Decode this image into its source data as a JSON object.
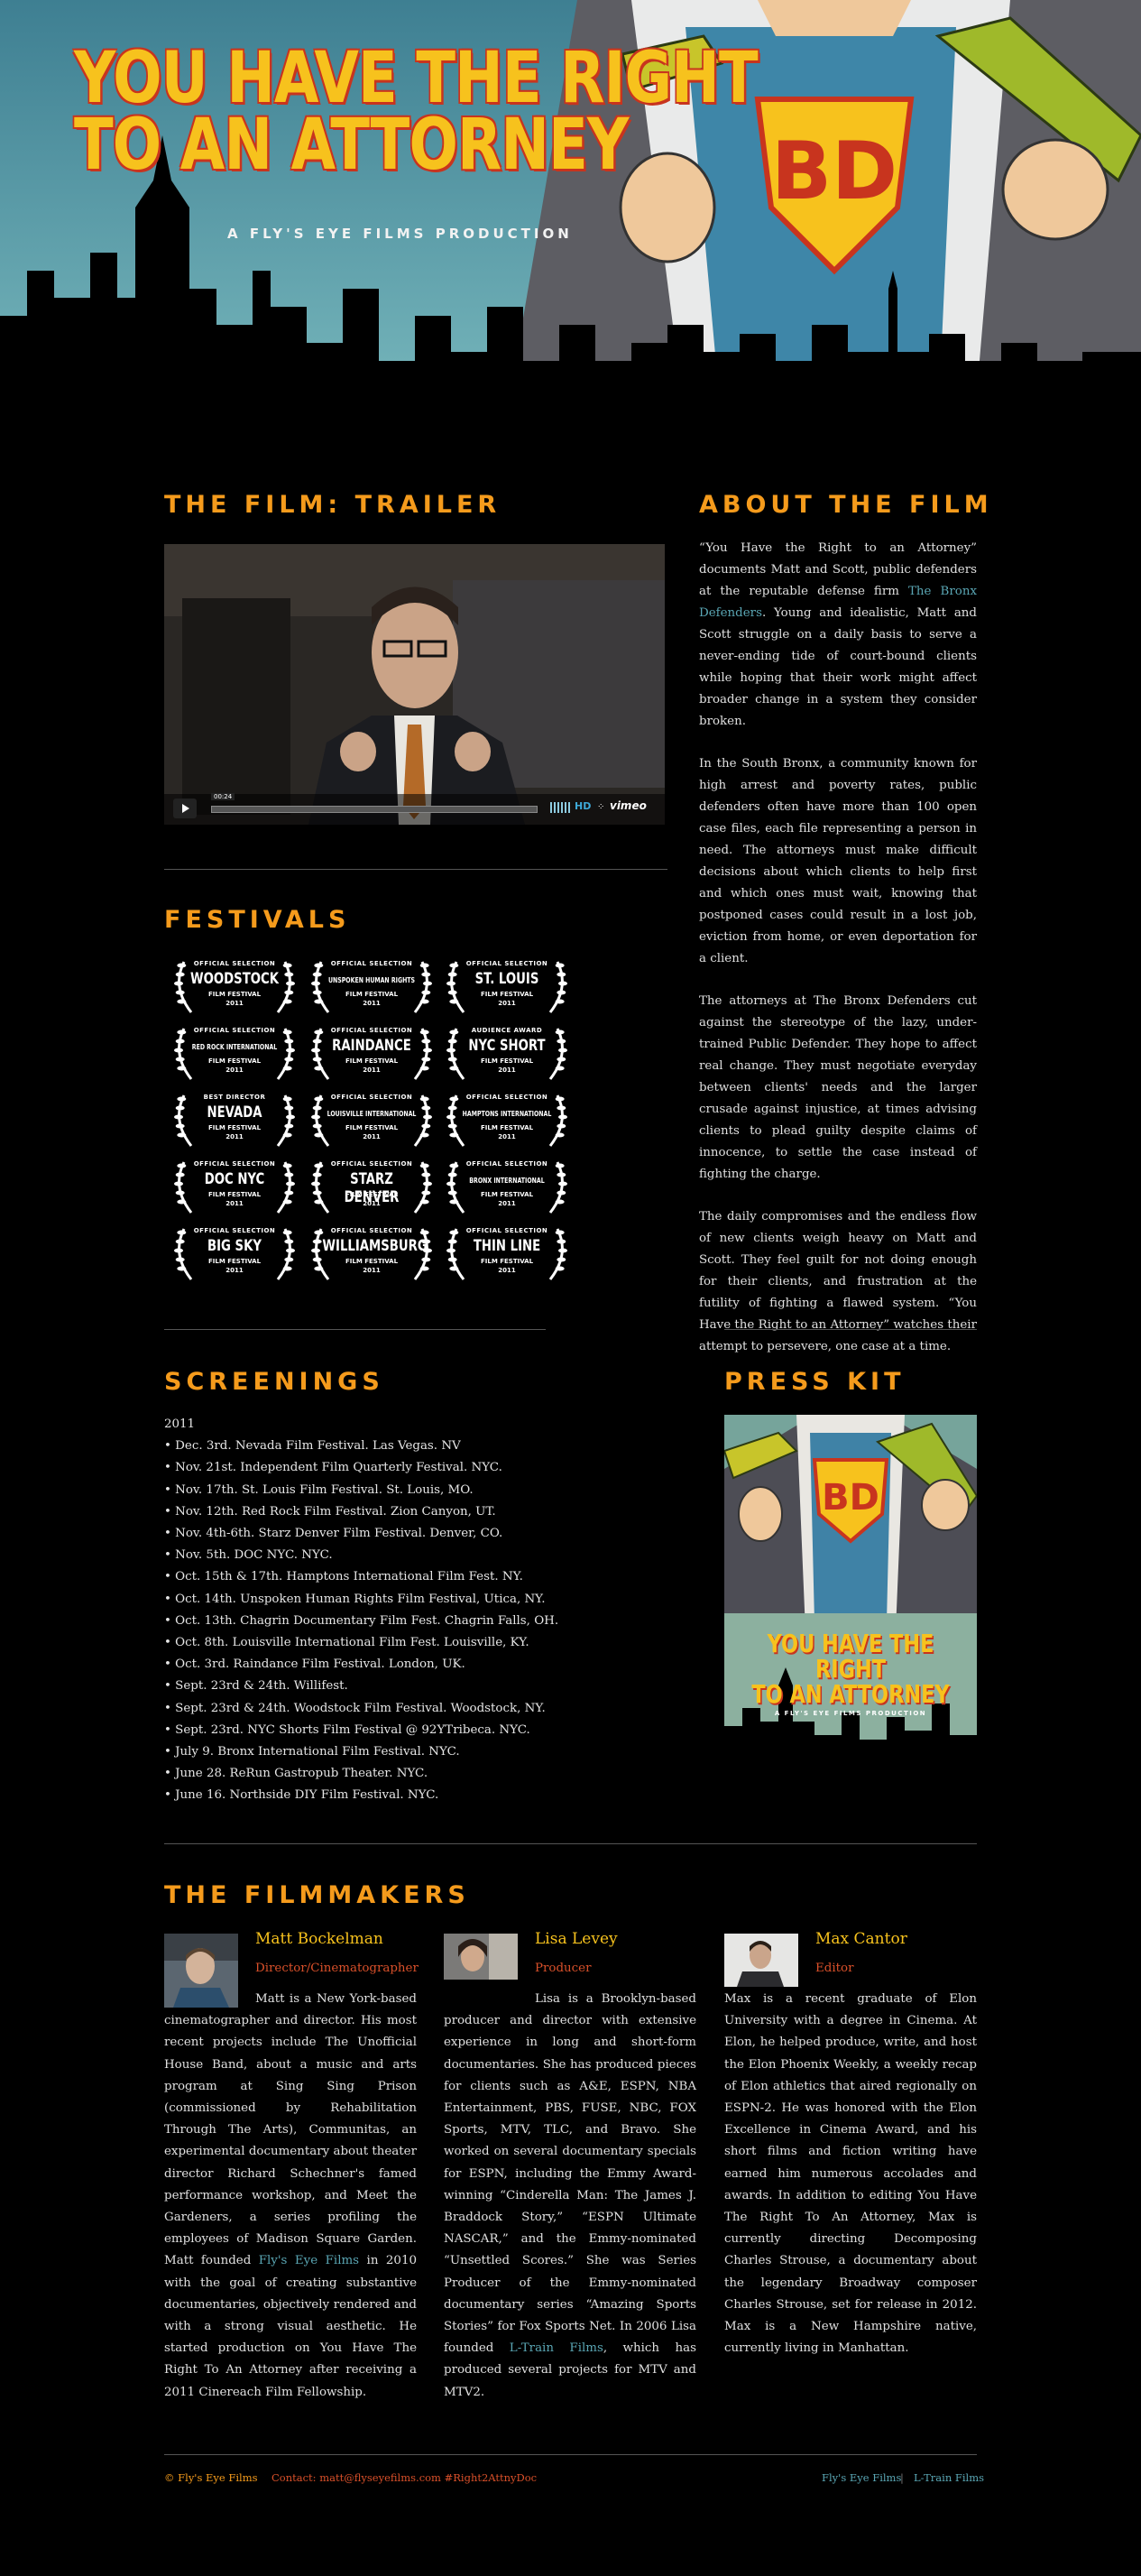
{
  "header": {
    "title_line1": "YOU HAVE THE RIGHT",
    "title_line2": "TO AN ATTORNEY",
    "subtitle": "A FLY'S EYE FILMS PRODUCTION",
    "emblem": "BD"
  },
  "trailer": {
    "heading": "THE FILM: TRAILER",
    "player": {
      "time": "00:24",
      "hd_label": "HD",
      "brand_label": "vimeo"
    }
  },
  "about": {
    "heading": "ABOUT THE FILM",
    "p1_before": "“You Have the Right to an Attorney” documents Matt and Scott, public defenders at the reputable defense firm ",
    "p1_link": "The Bronx Defenders",
    "p1_after": ". Young and idealistic, Matt and Scott struggle on a daily basis to serve a never-ending tide of court-bound clients while hoping that their work might affect broader change in a system they consider broken.",
    "p2": "In the South Bronx, a community known for high arrest and poverty rates, public defenders often have more than 100 open case files, each file representing a person in need. The attorneys must make difficult decisions about which clients to help first and which ones must wait, knowing that postponed cases could result in a lost job, eviction from home, or even deportation for a client.",
    "p3": "The attorneys at The Bronx Defenders cut against the stereotype of the lazy, under-trained Public Defender. They hope to affect real change. They must negotiate everyday between clients' needs and the larger crusade against injustice, at times advising clients to plead guilty despite claims of innocence, to settle the case instead of fighting the charge.",
    "p4": "The daily compromises and the endless flow of new clients weigh heavy on Matt and Scott. They feel guilt for not doing enough for their clients, and frustration at the futility of fighting a flawed system. “You Have the Right to an Attorney” watches their attempt to persevere, one case at a time."
  },
  "festivals": {
    "heading": "FESTIVALS",
    "laurels": [
      {
        "top": "OFFICIAL SELECTION",
        "name": "WOODSTOCK",
        "sub": "FILM FESTIVAL",
        "year": "2011",
        "big": true
      },
      {
        "top": "OFFICIAL SELECTION",
        "name": "UNSPOKEN HUMAN RIGHTS",
        "sub": "FILM FESTIVAL",
        "year": "2011",
        "big": false
      },
      {
        "top": "OFFICIAL SELECTION",
        "name": "ST. LOUIS",
        "sub": "FILM FESTIVAL",
        "year": "2011",
        "big": true
      },
      {
        "top": "OFFICIAL SELECTION",
        "name": "RED ROCK INTERNATIONAL",
        "sub": "FILM FESTIVAL",
        "year": "2011",
        "big": false
      },
      {
        "top": "OFFICIAL SELECTION",
        "name": "RAINDANCE",
        "sub": "FILM FESTIVAL",
        "year": "2011",
        "big": true
      },
      {
        "top": "AUDIENCE AWARD",
        "name": "NYC SHORT",
        "sub": "FILM FESTIVAL",
        "year": "2011",
        "big": true
      },
      {
        "top": "BEST DIRECTOR",
        "name": "NEVADA",
        "sub": "FILM FESTIVAL",
        "year": "2011",
        "big": true
      },
      {
        "top": "OFFICIAL SELECTION",
        "name": "LOUISVILLE INTERNATIONAL",
        "sub": "FILM FESTIVAL",
        "year": "2011",
        "big": false
      },
      {
        "top": "OFFICIAL SELECTION",
        "name": "HAMPTONS INTERNATIONAL",
        "sub": "FILM FESTIVAL",
        "year": "2011",
        "big": false
      },
      {
        "top": "OFFICIAL SELECTION",
        "name": "DOC NYC",
        "sub": "FILM FESTIVAL",
        "year": "2011",
        "big": true
      },
      {
        "top": "OFFICIAL SELECTION",
        "name": "STARZ DENVER",
        "sub": "FILM FESTIVAL",
        "year": "2011",
        "big": true
      },
      {
        "top": "OFFICIAL SELECTION",
        "name": "BRONX INTERNATIONAL",
        "sub": "FILM FESTIVAL",
        "year": "2011",
        "big": false
      },
      {
        "top": "OFFICIAL SELECTION",
        "name": "BIG SKY",
        "sub": "FILM FESTIVAL",
        "year": "2011",
        "big": true
      },
      {
        "top": "OFFICIAL SELECTION",
        "name": "WILLIAMSBURG",
        "sub": "FILM FESTIVAL",
        "year": "2011",
        "big": true
      },
      {
        "top": "OFFICIAL SELECTION",
        "name": "THIN LINE",
        "sub": "FILM FESTIVAL",
        "year": "2011",
        "big": true
      }
    ]
  },
  "screenings": {
    "heading": "SCREENINGS",
    "year": "2011",
    "items": [
      "• Dec. 3rd. Nevada Film Festival. Las Vegas. NV",
      "• Nov. 21st. Independent Film Quarterly Festival. NYC.",
      "• Nov. 17th. St. Louis Film Festival. St. Louis, MO.",
      "• Nov. 12th. Red Rock Film Festival. Zion Canyon, UT.",
      "• Nov. 4th-6th. Starz Denver Film Festival. Denver, CO.",
      "• Nov. 5th. DOC NYC. NYC.",
      "• Oct. 15th & 17th. Hamptons International Film Fest. NY.",
      "• Oct. 14th. Unspoken Human Rights Film Festival, Utica, NY.",
      "• Oct. 13th. Chagrin Documentary Film Fest. Chagrin Falls, OH.",
      "• Oct. 8th. Louisville International Film Fest. Louisville, KY.",
      "• Oct. 3rd. Raindance Film Festival. London, UK.",
      "• Sept. 23rd & 24th. Willifest.",
      "• Sept. 23rd & 24th. Woodstock Film Festival. Woodstock, NY.",
      "• Sept. 23rd. NYC Shorts Film Festival @ 92YTribeca. NYC.",
      "• July 9. Bronx International Film Festival. NYC.",
      "• June 28. ReRun Gastropub Theater. NYC.",
      "• June 16. Northside DIY Film Festival. NYC."
    ]
  },
  "presskit": {
    "heading": "PRESS KIT",
    "poster_line1": "YOU HAVE THE RIGHT",
    "poster_line2": "TO AN ATTORNEY",
    "poster_sub": "A FLY'S EYE FILMS PRODUCTION"
  },
  "filmmakers": {
    "heading": "THE FILMMAKERS",
    "matt": {
      "name": "Matt Bockelman",
      "role": "Director/Cinematographer",
      "bio_before": "Matt is a New York-based cinematographer and director. His most recent projects include The Unofficial House Band, about a music and arts program at Sing Sing Prison (commissioned by Rehabilitation Through The Arts), Communitas, an experimental documentary about theater director Richard Schechner's famed performance workshop, and Meet the Gardeners, a series profiling the employees of Madison Square Garden. Matt founded ",
      "bio_link": "Fly's Eye Films",
      "bio_after": " in 2010 with the goal of creating substantive documentaries, objectively rendered and with a strong visual aesthetic. He started production on You Have The Right To An Attorney after receiving a 2011 Cinereach Film Fellowship."
    },
    "lisa": {
      "name": "Lisa Levey",
      "role": "Producer",
      "bio_before": "Lisa is a Brooklyn-based producer and director with extensive experience in long and short-form documentaries. She has produced pieces for clients such as A&E, ESPN, NBA Entertainment, PBS, FUSE, NBC, FOX Sports, MTV, TLC, and Bravo. She worked on several documentary specials for ESPN, including the Emmy Award-winning “Cinderella Man: The James J. Braddock Story,” “ESPN Ultimate NASCAR,” and the Emmy-nominated “Unsettled Scores.” She was Series Producer of the Emmy-nominated documentary series “Amazing Sports Stories” for Fox Sports Net. In 2006 Lisa founded ",
      "bio_link": "L-Train Films",
      "bio_after": ", which has produced several projects for MTV and MTV2."
    },
    "max": {
      "name": "Max Cantor",
      "role": "Editor",
      "bio": "Max is a recent graduate of Elon University with a degree in Cinema. At Elon, he helped produce, write, and host the Elon Phoenix Weekly, a weekly recap of Elon athletics that aired regionally on ESPN-2. He was honored with the Elon Excellence in Cinema Award, and his short films and fiction writing have earned him numerous accolades and awards. In addition to editing You Have The Right To An Attorney, Max is currently directing Decomposing Charles Strouse, a documentary about the legendary Broadway composer Charles Strouse, set for release in 2012. Max is a New Hampshire native, currently living in Manhattan."
    }
  },
  "footer": {
    "copyright": "© Fly's Eye Films",
    "contact": "Contact:  matt@flyseyefilms.com  #Right2AttnyDoc",
    "link1": "Fly's Eye Films",
    "sep": "|",
    "link2": "L-Train Films"
  },
  "colors": {
    "accent": "#f59b1c",
    "title": "#f7c21d",
    "link": "#5aa6b4",
    "role": "#d9502a",
    "sky": "#5ea3b0"
  }
}
